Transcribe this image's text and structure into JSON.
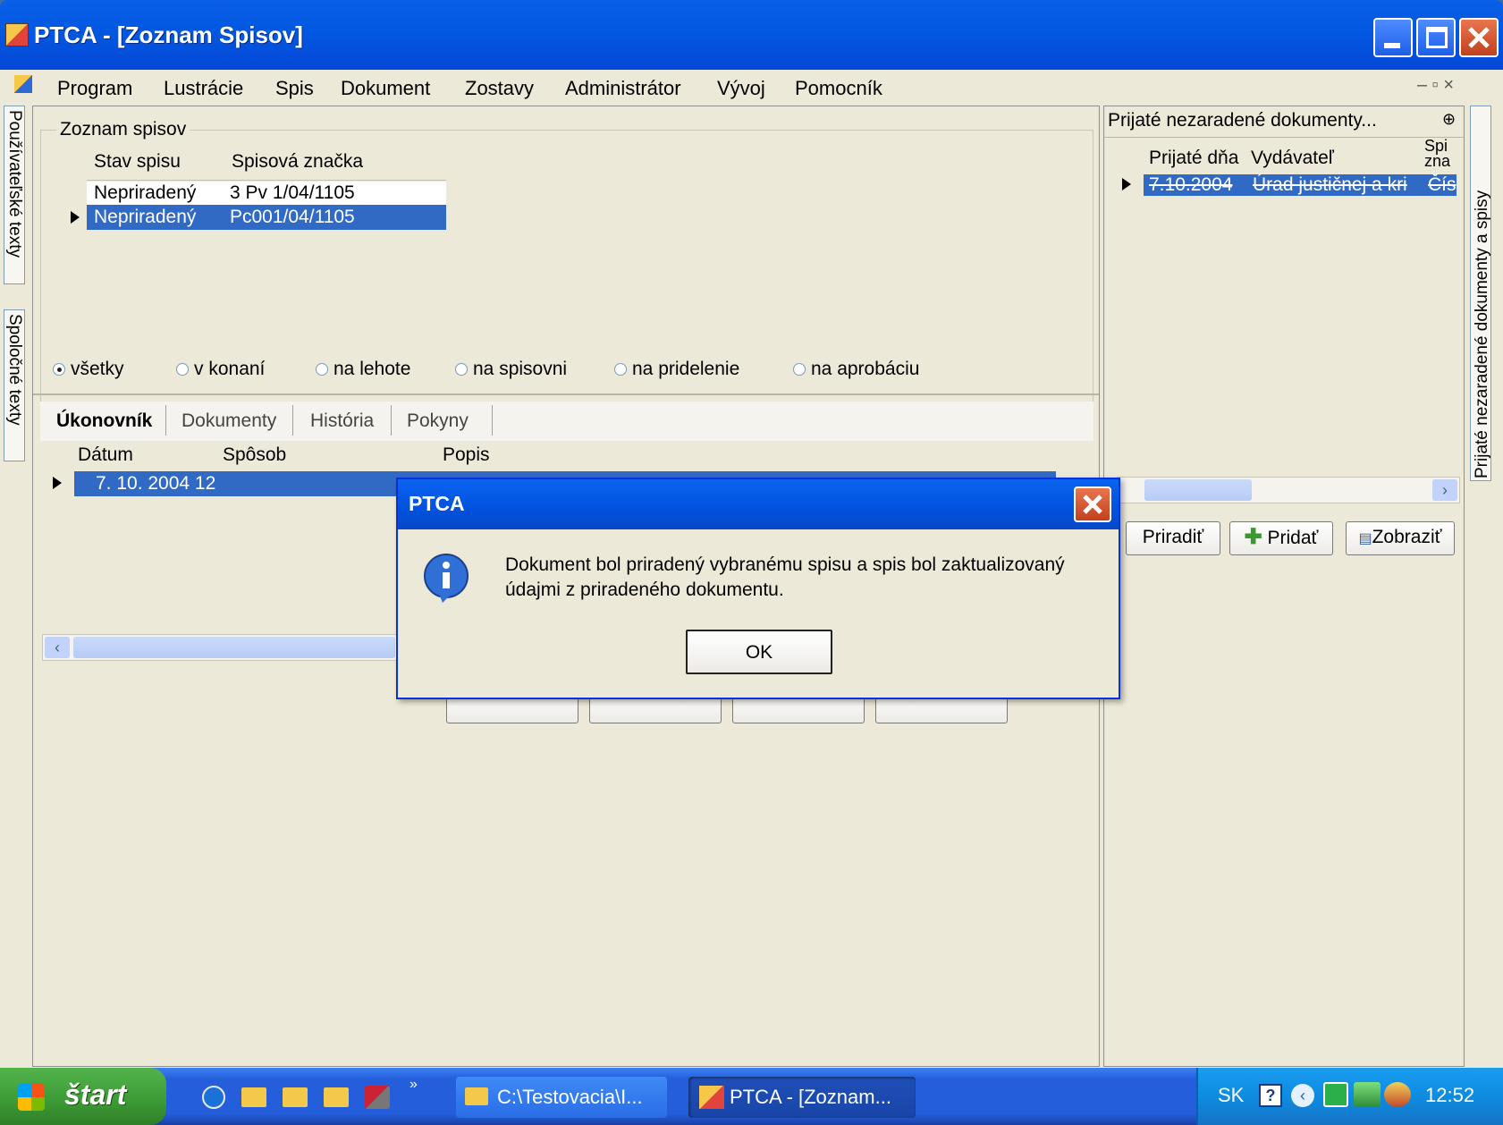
{
  "window": {
    "title": "PTCA - [Zoznam Spisov]",
    "restore_glyph": "– ▫ ×"
  },
  "menu": [
    "Program",
    "Lustrácie",
    "Spis",
    "Dokument",
    "Zostavy",
    "Administrátor",
    "Vývoj",
    "Pomocník"
  ],
  "side_tabs": {
    "left": [
      "Používateľské texty",
      "Spoločné texty"
    ],
    "right": "Prijaté nezaradené dokumenty a spisy"
  },
  "spisy": {
    "group_label": "Zoznam spisov",
    "columns": [
      "Stav spisu",
      "Spisová značka"
    ],
    "rows": [
      {
        "stav": "Nepriradený",
        "znacka": "3 Pv 1/04/1105"
      },
      {
        "stav": "Nepriradený",
        "znacka": "Pc001/04/1105"
      }
    ]
  },
  "filters": [
    "všetky",
    "v konaní",
    "na lehote",
    "na spisovni",
    "na pridelenie",
    "na aprobáciu"
  ],
  "tabs": [
    "Úkonovník",
    "Dokumenty",
    "História",
    "Pokyny"
  ],
  "ukony": {
    "columns": [
      "Dátum",
      "Spôsob",
      "Popis"
    ],
    "rows": [
      {
        "datum": "7. 10. 2004 12:",
        "sposob": "",
        "popis": ""
      }
    ]
  },
  "right_panel": {
    "title": "Prijaté nezaradené dokumenty...",
    "columns": [
      "Prijaté dňa",
      "Vydávateľ",
      "Spi zna"
    ],
    "rows": [
      {
        "datum": "7.10.2004",
        "vydavatel": "Úrad justičnej a kri",
        "cislo": "Čís"
      }
    ],
    "buttons": {
      "assign": "Priradiť",
      "add": "Pridať",
      "show": "Zobraziť"
    }
  },
  "dialog": {
    "title": "PTCA",
    "message_line1": "Dokument bol priradený vybranému spisu a spis bol zaktualizovaný",
    "message_line2": "údajmi z priradeného dokumentu.",
    "ok": "OK"
  },
  "taskbar": {
    "start": "štart",
    "tasks": [
      "C:\\Testovacia\\I...",
      "PTCA - [Zoznam..."
    ],
    "lang": "SK",
    "clock": "12:52"
  },
  "colors": {
    "selection": "#316ac5",
    "xp_blue": "#0a5ee8",
    "start_green": "#3c9a34"
  }
}
